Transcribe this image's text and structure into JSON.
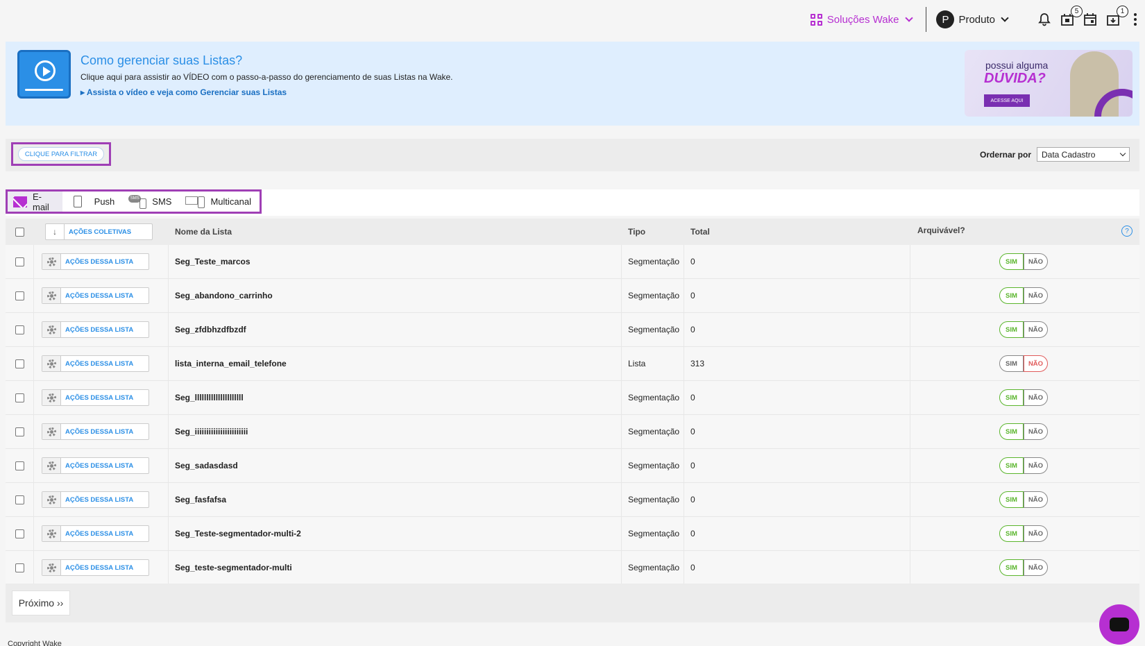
{
  "header": {
    "solucoes_label": "Soluções Wake",
    "avatar_letter": "P",
    "user_label": "Produto",
    "badge_calendar_box": "5",
    "badge_download": "1"
  },
  "banner": {
    "title": "Como gerenciar suas Listas?",
    "description": "Clique aqui para assistir ao VÍDEO com o passo-a-passo do gerenciamento de suas Listas na Wake.",
    "link": "Assista o vídeo e veja como Gerenciar suas Listas",
    "promo_line1": "possui alguma",
    "promo_line2": "DÚVIDA?",
    "promo_button": "ACESSE AQUI"
  },
  "filter": {
    "button": "CLIQUE PARA FILTRAR",
    "order_label": "Ordernar por",
    "order_value": "Data Cadastro"
  },
  "tabs": [
    {
      "label": "E-mail",
      "icon": "envelope-icon"
    },
    {
      "label": "Push",
      "icon": "mobile-icon"
    },
    {
      "label": "SMS",
      "icon": "sms-icon"
    },
    {
      "label": "Multicanal",
      "icon": "multichannel-icon"
    }
  ],
  "table": {
    "bulk_actions": "AÇÕES COLETIVAS",
    "headers": {
      "name": "Nome da Lista",
      "tipo": "Tipo",
      "total": "Total",
      "arch": "Arquivável?",
      "help": "?"
    },
    "row_action": "AÇÕES DESSA LISTA",
    "yes": "SIM",
    "no": "NÃO",
    "rows": [
      {
        "name": "Seg_Teste_marcos",
        "tipo": "Segmentação",
        "total": "0",
        "archivable": true
      },
      {
        "name": "Seg_abandono_carrinho",
        "tipo": "Segmentação",
        "total": "0",
        "archivable": true
      },
      {
        "name": "Seg_zfdbhzdfbzdf",
        "tipo": "Segmentação",
        "total": "0",
        "archivable": true
      },
      {
        "name": "lista_interna_email_telefone",
        "tipo": "Lista",
        "total": "313",
        "archivable": false
      },
      {
        "name": "Seg_lllllllllllllllllllll",
        "tipo": "Segmentação",
        "total": "0",
        "archivable": true
      },
      {
        "name": "Seg_iiiiiiiiiiiiiiiiiiiiiii",
        "tipo": "Segmentação",
        "total": "0",
        "archivable": true
      },
      {
        "name": "Seg_sadasdasd",
        "tipo": "Segmentação",
        "total": "0",
        "archivable": true
      },
      {
        "name": "Seg_fasfafsa",
        "tipo": "Segmentação",
        "total": "0",
        "archivable": true
      },
      {
        "name": "Seg_Teste-segmentador-multi-2",
        "tipo": "Segmentação",
        "total": "0",
        "archivable": true
      },
      {
        "name": "Seg_teste-segmentador-multi",
        "tipo": "Segmentação",
        "total": "0",
        "archivable": true
      }
    ]
  },
  "pager": {
    "next": "Próximo ››"
  },
  "footer": {
    "copyright": "Copyright Wake"
  },
  "colors": {
    "accent": "#b62fd1",
    "link": "#2b8fe6",
    "yes": "#5ab52c",
    "no": "#e05a5a"
  }
}
